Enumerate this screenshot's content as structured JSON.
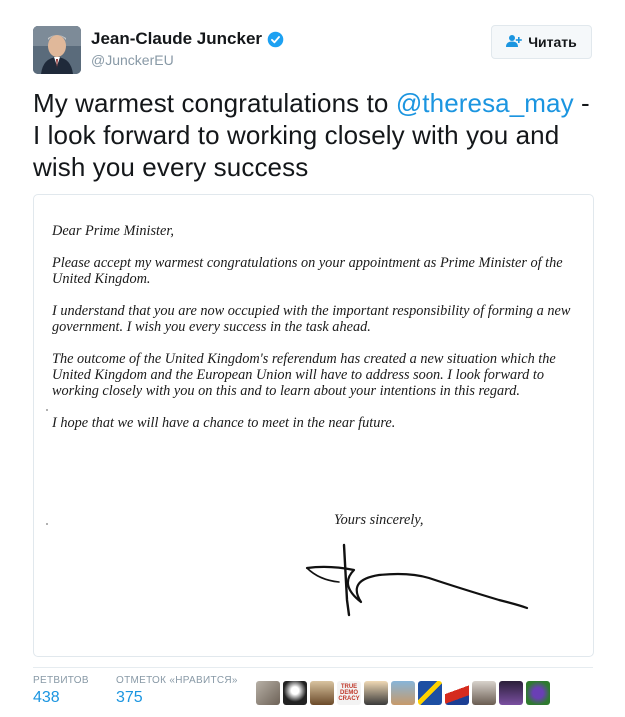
{
  "author": {
    "name": "Jean-Claude Juncker",
    "handle": "@JunckerEU"
  },
  "follow_button": {
    "label": "Читать"
  },
  "tweet": {
    "text_before": "My warmest congratulations to ",
    "mention": "@theresa_may",
    "text_after": " - I look forward to working closely with you and wish you every success"
  },
  "letter": {
    "paragraphs": [
      "Dear Prime Minister,",
      "Please accept my warmest congratulations on your appointment as Prime Minister of the United Kingdom.",
      "I understand that you are now occupied with the important responsibility of forming a new government. I wish you every success in the task ahead.",
      "The outcome of the United Kingdom's referendum has created a new situation which the United Kingdom and the European Union will have to address soon. I look forward to working closely with you on this and to learn about your intentions in this regard.",
      "I hope that we will have a chance to meet in the near future."
    ],
    "closing": "Yours sincerely,"
  },
  "stats": {
    "retweets_label": "РЕТВИТОВ",
    "retweets": "438",
    "likes_label": "ОТМЕТОК «НРАВИТСЯ»",
    "likes": "375"
  },
  "likers_badge_text": "TRUE DEMO CRACY",
  "colors": {
    "link": "#1b95e0",
    "muted": "#8899a6",
    "verified": "#1da1f2",
    "border": "#e1e8ed"
  },
  "icons": [
    "verified-badge-icon",
    "follow-user-icon"
  ]
}
